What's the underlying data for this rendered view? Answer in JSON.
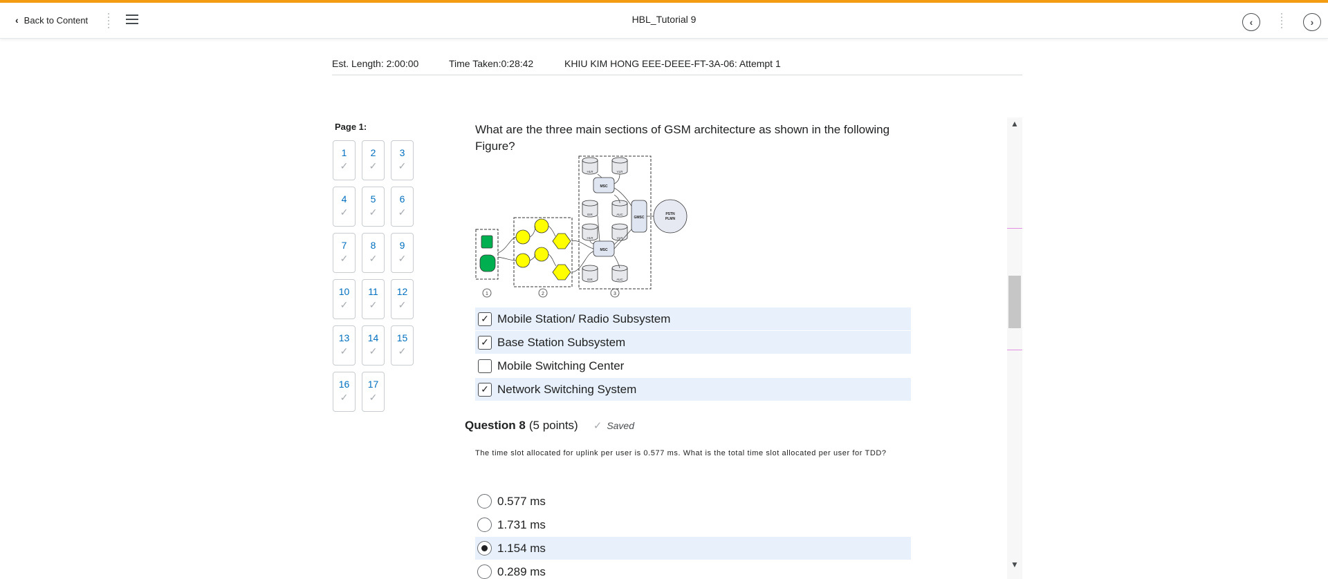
{
  "nav": {
    "back_label": "Back to Content",
    "title": "HBL_Tutorial 9"
  },
  "info": {
    "est_length": "Est. Length: 2:00:00",
    "time_taken": "Time Taken:0:28:42",
    "attempt": "KHIU KIM HONG EEE-DEEE-FT-3A-06: Attempt 1"
  },
  "question_nav": {
    "page_label": "Page 1:",
    "questions": [
      "1",
      "2",
      "3",
      "4",
      "5",
      "6",
      "7",
      "8",
      "9",
      "10",
      "11",
      "12",
      "13",
      "14",
      "15",
      "16",
      "17"
    ]
  },
  "question7": {
    "text": "What are the three main sections of GSM architecture as shown in the following Figure?",
    "figure_labels": {
      "msc": "MSC",
      "gmsc": "GMSC",
      "pstn": "PSTN",
      "plmn": "PLMN",
      "hlr": "HLR",
      "vlr": "VLR",
      "eir": "EIR",
      "auc": "AUC",
      "section1": "1",
      "section2": "2",
      "section3": "3"
    },
    "options": [
      {
        "label": "Mobile Station/ Radio Subsystem",
        "checked": true
      },
      {
        "label": "Base Station Subsystem",
        "checked": true
      },
      {
        "label": "Mobile Switching Center",
        "checked": false
      },
      {
        "label": "Network Switching System",
        "checked": true
      }
    ]
  },
  "question8": {
    "title": "Question 8",
    "points": "(5 points)",
    "status": "Saved",
    "text": "The time slot allocated for uplink per user is 0.577 ms. What is the total time slot allocated per user for TDD?",
    "options": [
      {
        "label": "0.577 ms",
        "selected": false
      },
      {
        "label": "1.731 ms",
        "selected": false
      },
      {
        "label": "1.154 ms",
        "selected": true
      },
      {
        "label": "0.289 ms",
        "selected": false
      }
    ]
  },
  "icons": {
    "check": "✓",
    "prev": "‹",
    "next": "›",
    "scroll_up": "⌃",
    "scroll_down": "⌄"
  },
  "colors": {
    "accent": "#f39c12",
    "link": "#006fbf",
    "selected_bg": "#e8f1fb",
    "green": "#00b050",
    "yellow": "#ffff00"
  }
}
